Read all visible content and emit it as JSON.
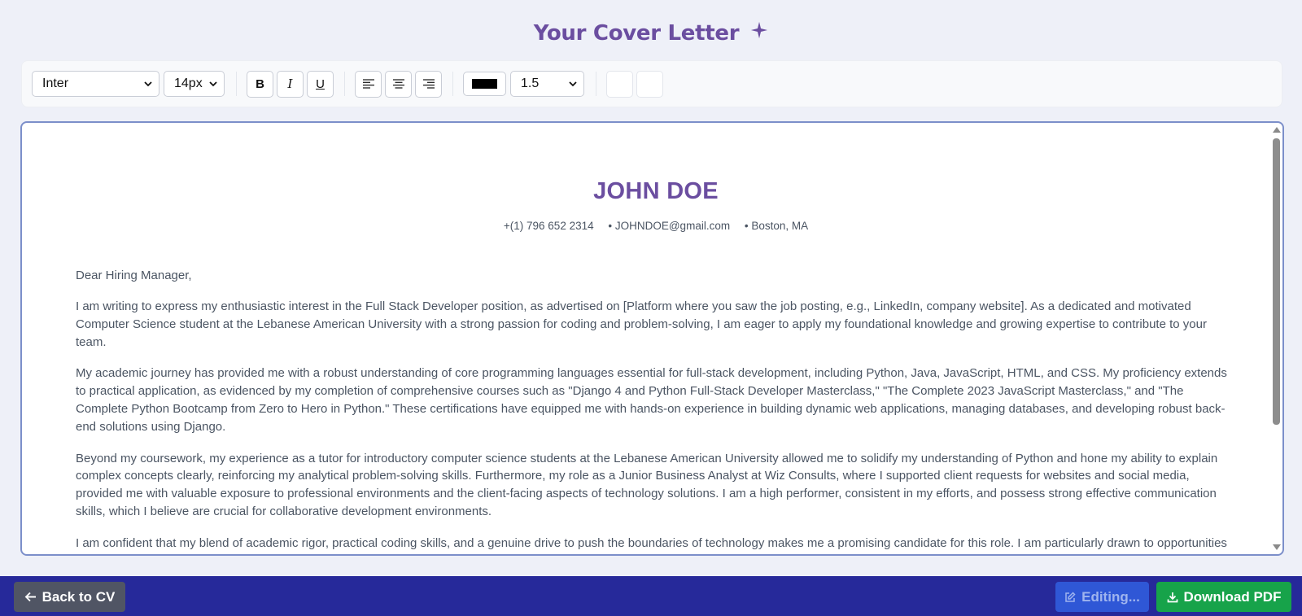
{
  "header": {
    "title": "Your Cover Letter",
    "icon": "sparkle-icon",
    "accent": "#6b4ea0"
  },
  "toolbar": {
    "font_family": "Inter",
    "font_size": "14px",
    "bold_label": "B",
    "italic_label": "I",
    "underline_label": "U",
    "align_icons": [
      "align-left-icon",
      "align-center-icon",
      "align-right-icon"
    ],
    "text_color": "#000000",
    "line_height": "1.5"
  },
  "letter": {
    "name": "JOHN DOE",
    "phone": "+(1) 796 652 2314",
    "email": "• JOHNDOE@gmail.com",
    "location": "• Boston, MA",
    "greeting": "Dear Hiring Manager,",
    "paragraphs": [
      "I am writing to express my enthusiastic interest in the Full Stack Developer position, as advertised on [Platform where you saw the job posting, e.g., LinkedIn, company website]. As a dedicated and motivated Computer Science student at the Lebanese American University with a strong passion for coding and problem-solving, I am eager to apply my foundational knowledge and growing expertise to contribute to your team.",
      "My academic journey has provided me with a robust understanding of core programming languages essential for full-stack development, including Python, Java, JavaScript, HTML, and CSS. My proficiency extends to practical application, as evidenced by my completion of comprehensive courses such as \"Django 4 and Python Full-Stack Developer Masterclass,\" \"The Complete 2023 JavaScript Masterclass,\" and \"The Complete Python Bootcamp from Zero to Hero in Python.\" These certifications have equipped me with hands-on experience in building dynamic web applications, managing databases, and developing robust back-end solutions using Django.",
      "Beyond my coursework, my experience as a tutor for introductory computer science students at the Lebanese American University allowed me to solidify my understanding of Python and hone my ability to explain complex concepts clearly, reinforcing my analytical problem-solving skills. Furthermore, my role as a Junior Business Analyst at Wiz Consults, where I supported client requests for websites and social media, provided me with valuable exposure to professional environments and the client-facing aspects of technology solutions. I am a high performer, consistent in my efforts, and possess strong effective communication skills, which I believe are crucial for collaborative development environments.",
      "I am confident that my blend of academic rigor, practical coding skills, and a genuine drive to push the boundaries of technology makes me a promising candidate for this role. I am particularly drawn to opportunities that allow me to contribute to the digital future and continuously learn and grow within a dynamic team."
    ]
  },
  "footer": {
    "back_label": "Back to CV",
    "editing_label": "Editing...",
    "download_label": "Download PDF",
    "bar_color": "#26299a",
    "download_color": "#17a34a"
  }
}
